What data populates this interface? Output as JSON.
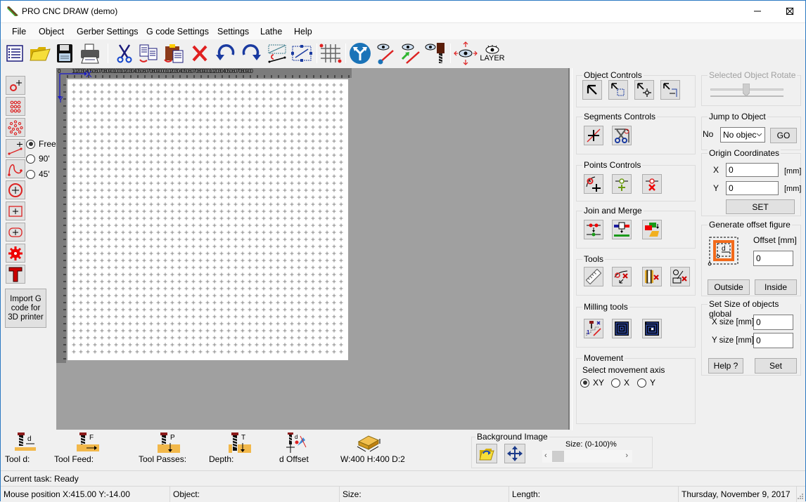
{
  "window": {
    "title": "PRO CNC DRAW (demo)",
    "controls": [
      "minimize",
      "maximize",
      "close"
    ]
  },
  "menu": [
    "File",
    "Object",
    "Gerber Settings",
    "G code Settings",
    "Settings",
    "Lathe",
    "Help"
  ],
  "toolbar": {
    "items": [
      "list-icon",
      "open-folder-icon",
      "save-icon",
      "print-icon",
      "cut-icon",
      "copy-icon",
      "paste-icon",
      "delete-icon",
      "undo-icon",
      "redo-icon",
      "reverse-direction-icon",
      "select-path-icon",
      "grid-icon",
      "split-arrows-icon",
      "view-path-icon",
      "view-start-icon",
      "view-tool-icon",
      "view-move-icon",
      "layer-icon"
    ],
    "layer_label": "LAYER"
  },
  "left_tools": {
    "buttons": [
      "add-point-icon",
      "point-grid-icon",
      "point-circle-icon",
      "line-icon",
      "curve-icon",
      "circle-icon",
      "rectangle-icon",
      "rounded-rect-icon",
      "gear-icon",
      "text-icon"
    ],
    "angle_mode": {
      "options": [
        "Free",
        "90'",
        "45'"
      ],
      "selected": "Free"
    },
    "import_button": "Import G code for 3D printer"
  },
  "canvas": {
    "ruler_top": "1020304050607080901001020304050607080900010203040506070809001020304050607080900",
    "axis_x": "X",
    "axis_y": "Y",
    "origin": "0"
  },
  "right_panel": {
    "object_controls": {
      "label": "Object Controls",
      "buttons": [
        "select-icon",
        "select-box-icon",
        "move-icon",
        "scale-icon"
      ]
    },
    "segments_controls": {
      "label": "Segments Controls",
      "buttons": [
        "split-segment-icon",
        "cut-segment-icon"
      ]
    },
    "points_controls": {
      "label": "Points Controls",
      "buttons": [
        "add-node-icon",
        "insert-node-icon",
        "delete-node-icon"
      ]
    },
    "join_merge": {
      "label": "Join and Merge",
      "buttons": [
        "join-icon",
        "merge-icon",
        "combine-icon"
      ]
    },
    "tools": {
      "label": "Tools",
      "buttons": [
        "ruler-icon",
        "remove-point-icon",
        "remove-fill-icon",
        "remove-shape-icon"
      ]
    },
    "milling_tools": {
      "label": "Milling tools",
      "buttons": [
        "ramp-icon",
        "pocket-icon",
        "spiral-pocket-icon"
      ]
    },
    "movement": {
      "label": "Movement",
      "sublabel": "Select movement axis",
      "options": [
        "XY",
        "X",
        "Y"
      ],
      "selected": "XY"
    },
    "rotate": {
      "label": "Selected Object Rotate"
    },
    "jump": {
      "label": "Jump to Object",
      "no_label": "No",
      "select_value": "No objec",
      "go": "GO"
    },
    "origin": {
      "label": "Origin Coordinates",
      "x_label": "X",
      "y_label": "Y",
      "x_value": "0",
      "y_value": "0",
      "unit": "[mm]",
      "set": "SET"
    },
    "offset": {
      "label": "Generate offset figure",
      "offset_label": "Offset [mm]",
      "value": "0",
      "d_label": "d",
      "outside": "Outside",
      "inside": "Inside"
    },
    "size": {
      "label": "Set Size of objects global",
      "x_label": "X size [mm]",
      "y_label": "Y size [mm]",
      "x_value": "0",
      "y_value": "0",
      "help": "Help ?",
      "set": "Set"
    }
  },
  "bottom": {
    "tool_d": "Tool d:",
    "tool_feed": "Tool Feed:",
    "tool_passes": "Tool Passes:",
    "depth": "Depth:",
    "d_offset": "d Offset",
    "dimensions": "W:400 H:400 D:2",
    "icon_letters": {
      "d": "d",
      "f": "F",
      "p": "P",
      "t": "T"
    },
    "background_image": {
      "label": "Background Image",
      "size_label": "Size: (0-100)%",
      "size_value": 0
    }
  },
  "status": {
    "task": "Current task: Ready",
    "mouse": "Mouse position X:415.00 Y:-14.00",
    "object": "Object:",
    "size": "Size:",
    "length": "Length:",
    "date": "Thursday, November 9, 2017"
  }
}
